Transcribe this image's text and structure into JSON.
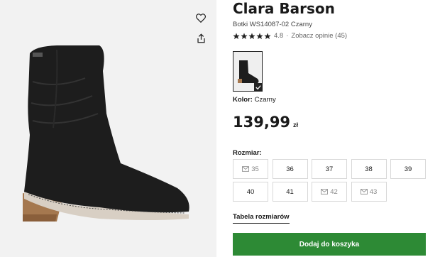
{
  "product": {
    "brand": "Clara Barson",
    "model": "Botki WS14087-02 Czarny",
    "rating_value": "4.8",
    "rating_separator": "·",
    "reviews_link": "Zobacz opinie (45)"
  },
  "color": {
    "label": "Kolor:",
    "value": "Czarny"
  },
  "price": {
    "value": "139,99",
    "currency": "zł"
  },
  "sizes": {
    "title": "Rozmiar:",
    "items": [
      {
        "label": "35",
        "available": false
      },
      {
        "label": "36",
        "available": true
      },
      {
        "label": "37",
        "available": true
      },
      {
        "label": "38",
        "available": true
      },
      {
        "label": "39",
        "available": true
      },
      {
        "label": "40",
        "available": true
      },
      {
        "label": "41",
        "available": true
      },
      {
        "label": "42",
        "available": false
      },
      {
        "label": "43",
        "available": false
      }
    ]
  },
  "size_chart_link": "Tabela rozmiarów",
  "cta": {
    "label": "Dodaj do koszyka",
    "color": "#2d8a35"
  },
  "icons": [
    "heart-icon",
    "share-icon",
    "star-icon",
    "mail-icon",
    "check-icon"
  ]
}
